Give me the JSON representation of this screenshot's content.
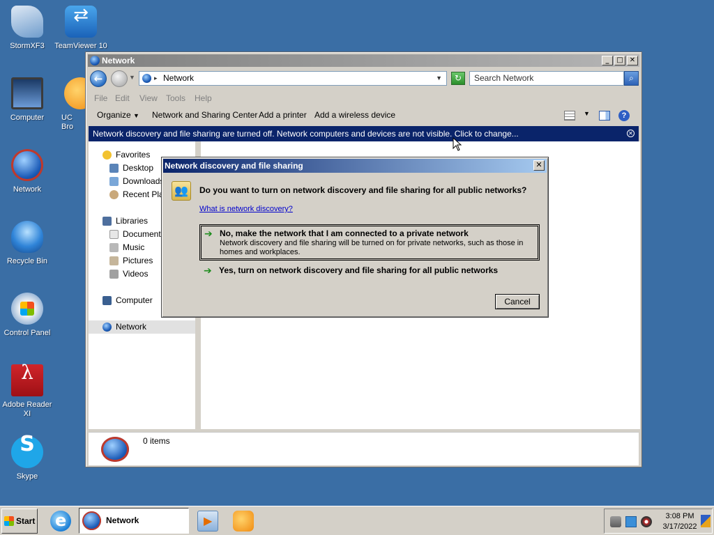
{
  "desktop": {
    "icons": [
      {
        "label": "StormXF3",
        "icon": "stormxf3-icon"
      },
      {
        "label": "TeamViewer 10",
        "icon": "teamviewer-icon"
      },
      {
        "label": "Computer",
        "icon": "computer-icon"
      },
      {
        "label": "UC Bro",
        "icon": "uc-browser-icon"
      },
      {
        "label": "Network",
        "icon": "network-icon"
      },
      {
        "label": "Recycle Bin",
        "icon": "recycle-bin-icon"
      },
      {
        "label": "Control Panel",
        "icon": "control-panel-icon"
      },
      {
        "label": "Adobe Reader XI",
        "icon": "adobe-reader-icon"
      },
      {
        "label": "Skype",
        "icon": "skype-icon"
      }
    ]
  },
  "window": {
    "title": "Network",
    "address": "Network",
    "search_placeholder": "Search Network",
    "menu": [
      "File",
      "Edit",
      "View",
      "Tools",
      "Help"
    ],
    "commands": {
      "organize": "Organize",
      "network_sharing_center": "Network and Sharing Center",
      "add_printer": "Add a printer",
      "add_wireless": "Add a wireless device"
    },
    "infobar": "Network discovery and file sharing are turned off. Network computers and devices are not visible. Click to change...",
    "nav": {
      "favorites": "Favorites",
      "desktop": "Desktop",
      "downloads": "Downloads",
      "recent": "Recent Plac",
      "libraries": "Libraries",
      "documents": "Documents",
      "music": "Music",
      "pictures": "Pictures",
      "videos": "Videos",
      "computer": "Computer",
      "network": "Network"
    },
    "details": "0 items"
  },
  "dialog": {
    "title": "Network discovery and file sharing",
    "question": "Do you want to turn on network discovery and file sharing for all public networks?",
    "link": "What is network discovery?",
    "option_private_title": "No, make the network that I am connected to a private network",
    "option_private_desc": "Network discovery and file sharing will be turned on for private networks, such as those in homes and workplaces.",
    "option_public_title": "Yes, turn on network discovery and file sharing for all public networks",
    "cancel": "Cancel"
  },
  "taskbar": {
    "start": "Start",
    "active_task": "Network",
    "time": "3:08 PM",
    "date": "3/17/2022"
  },
  "colors": {
    "desktop": "#3a6ea5",
    "infobar": "#0a246a",
    "dialog_title_start": "#0a246a",
    "dialog_title_end": "#a6caf0"
  }
}
